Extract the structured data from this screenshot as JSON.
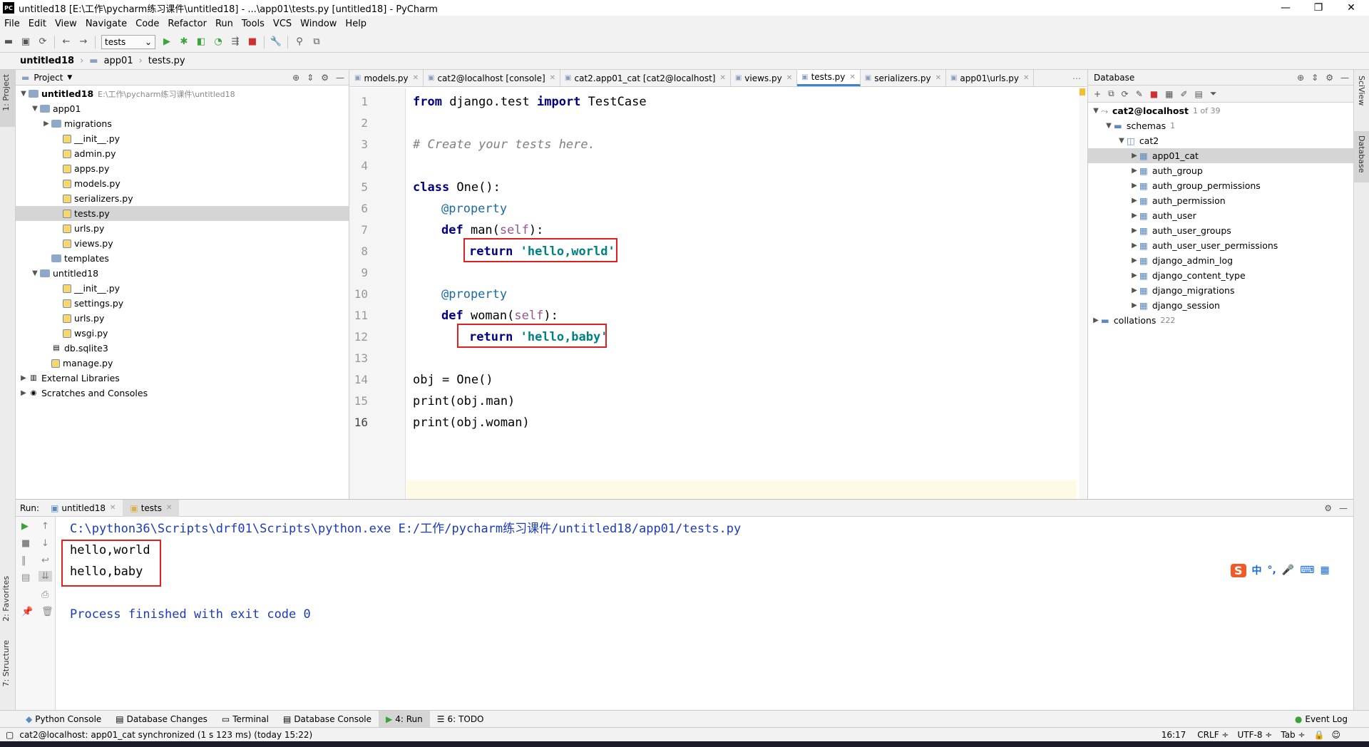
{
  "window": {
    "title": "untitled18 [E:\\工作\\pycharm练习课件\\untitled18] - ...\\app01\\tests.py [untitled18] - PyCharm",
    "logo": "PC",
    "minimize": "—",
    "maximize": "❐",
    "close": "✕"
  },
  "menu": [
    "File",
    "Edit",
    "View",
    "Navigate",
    "Code",
    "Refactor",
    "Run",
    "Tools",
    "VCS",
    "Window",
    "Help"
  ],
  "toolbar": {
    "run_config": "tests"
  },
  "breadcrumb": [
    "untitled18",
    "app01",
    "tests.py"
  ],
  "left_strip": {
    "project": "1: Project",
    "favorites": "2: Favorites",
    "structure": "7: Structure"
  },
  "right_strip": {
    "sciview": "SciView",
    "database": "Database"
  },
  "project": {
    "header": "Project",
    "tree": [
      {
        "label": "untitled18",
        "extra": "E:\\工作\\pycharm练习课件\\untitled18",
        "depth": 0,
        "type": "folder",
        "arrow": "open",
        "bold": true
      },
      {
        "label": "app01",
        "depth": 1,
        "type": "folder",
        "arrow": "open"
      },
      {
        "label": "migrations",
        "depth": 2,
        "type": "folder",
        "arrow": "closed"
      },
      {
        "label": "__init__.py",
        "depth": 3,
        "type": "py"
      },
      {
        "label": "admin.py",
        "depth": 3,
        "type": "py"
      },
      {
        "label": "apps.py",
        "depth": 3,
        "type": "py"
      },
      {
        "label": "models.py",
        "depth": 3,
        "type": "py"
      },
      {
        "label": "serializers.py",
        "depth": 3,
        "type": "py"
      },
      {
        "label": "tests.py",
        "depth": 3,
        "type": "py",
        "selected": true
      },
      {
        "label": "urls.py",
        "depth": 3,
        "type": "py"
      },
      {
        "label": "views.py",
        "depth": 3,
        "type": "py"
      },
      {
        "label": "templates",
        "depth": 2,
        "type": "folder"
      },
      {
        "label": "untitled18",
        "depth": 1,
        "type": "folder",
        "arrow": "open"
      },
      {
        "label": "__init__.py",
        "depth": 3,
        "type": "py"
      },
      {
        "label": "settings.py",
        "depth": 3,
        "type": "py"
      },
      {
        "label": "urls.py",
        "depth": 3,
        "type": "py"
      },
      {
        "label": "wsgi.py",
        "depth": 3,
        "type": "py"
      },
      {
        "label": "db.sqlite3",
        "depth": 2,
        "type": "db"
      },
      {
        "label": "manage.py",
        "depth": 2,
        "type": "py"
      },
      {
        "label": "External Libraries",
        "depth": 0,
        "type": "lib",
        "arrow": "closed"
      },
      {
        "label": "Scratches and Consoles",
        "depth": 0,
        "type": "scratch",
        "arrow": "closed"
      }
    ]
  },
  "editor": {
    "tabs": [
      {
        "label": "models.py"
      },
      {
        "label": "cat2@localhost [console]"
      },
      {
        "label": "cat2.app01_cat [cat2@localhost]"
      },
      {
        "label": "views.py"
      },
      {
        "label": "tests.py",
        "active": true
      },
      {
        "label": "serializers.py"
      },
      {
        "label": "app01\\urls.py"
      }
    ],
    "lines": [
      "1",
      "2",
      "3",
      "4",
      "5",
      "6",
      "7",
      "8",
      "9",
      "10",
      "11",
      "12",
      "13",
      "14",
      "15",
      "16"
    ],
    "code": {
      "l1_from": "from",
      "l1_mod": " django.test ",
      "l1_import": "import",
      "l1_cls": " TestCase",
      "l3": "# Create your tests here.",
      "l5_class": "class",
      "l5_rest": " One():",
      "l6": "@property",
      "l7_def": "def",
      "l7_name": " man(",
      "l7_self": "self",
      "l7_end": "):",
      "l8_ret": "return",
      "l8_str": " 'hello,world'",
      "l10": "@property",
      "l11_def": "def",
      "l11_name": " woman(",
      "l11_self": "self",
      "l11_end": "):",
      "l12_ret": "return",
      "l12_str": " 'hello,baby'",
      "l14": "obj = One()",
      "l15": "print(obj.man)",
      "l16": "print(obj.woman)"
    }
  },
  "database": {
    "header": "Database",
    "connection": {
      "label": "cat2@localhost",
      "count": "1 of 39"
    },
    "schemas": {
      "label": "schemas",
      "count": "1"
    },
    "schema": "cat2",
    "tables": [
      "app01_cat",
      "auth_group",
      "auth_group_permissions",
      "auth_permission",
      "auth_user",
      "auth_user_groups",
      "auth_user_user_permissions",
      "django_admin_log",
      "django_content_type",
      "django_migrations",
      "django_session"
    ],
    "collations": {
      "label": "collations",
      "count": "222"
    }
  },
  "run": {
    "label": "Run:",
    "tabs": [
      "untitled18",
      "tests"
    ],
    "command": "C:\\python36\\Scripts\\drf01\\Scripts\\python.exe E:/工作/pycharm练习课件/untitled18/app01/tests.py",
    "output": [
      "hello,world",
      "hello,baby"
    ],
    "finished": "Process finished with exit code 0"
  },
  "bottom_tabs": [
    "Python Console",
    "Database Changes",
    "Terminal",
    "Database Console",
    "4: Run",
    "6: TODO"
  ],
  "event_log": "Event Log",
  "status": {
    "message": "cat2@localhost: app01_cat synchronized (1 s 123 ms) (today 15:22)",
    "position": "16:17",
    "line_sep": "CRLF ÷",
    "encoding": "UTF-8 ÷",
    "indent": "Tab ÷"
  },
  "ime": {
    "logo": "S",
    "items": [
      "中",
      "°,",
      "🎤",
      "⌨",
      "▦"
    ]
  }
}
